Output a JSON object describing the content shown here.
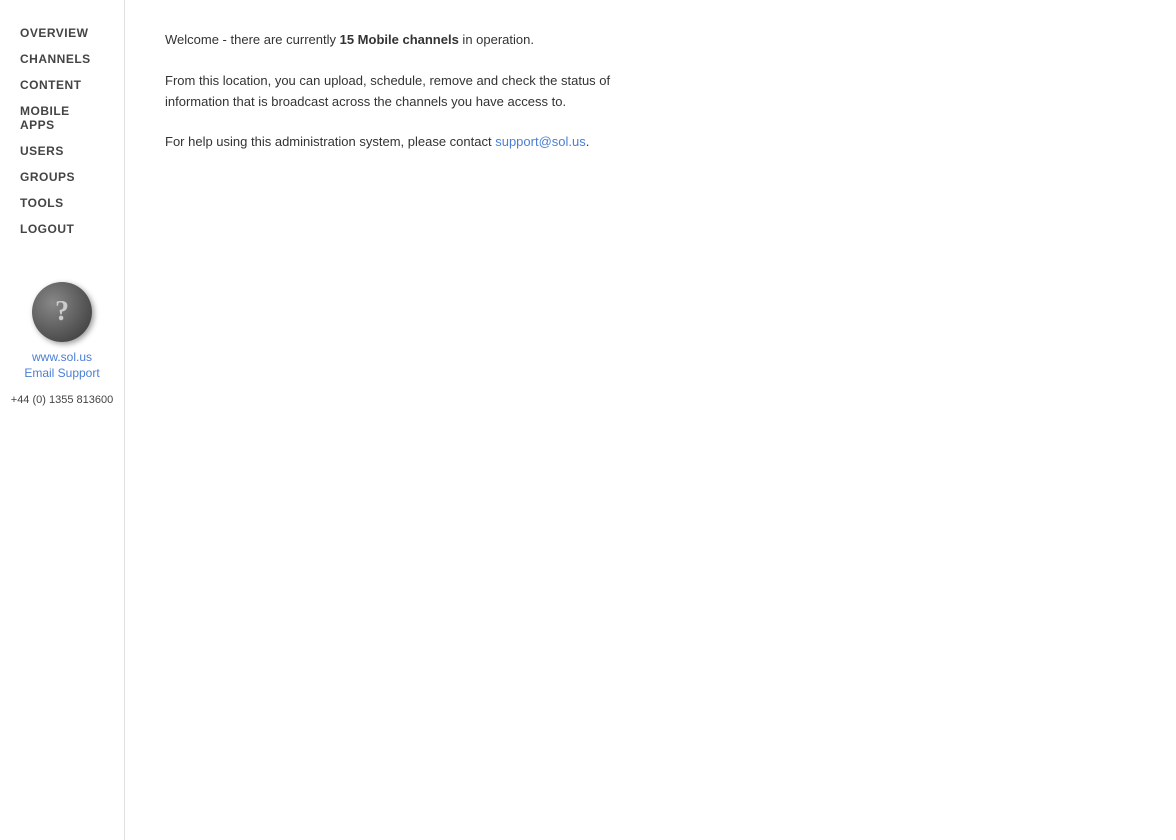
{
  "sidebar": {
    "nav_items": [
      {
        "label": "OVERVIEW",
        "id": "overview"
      },
      {
        "label": "CHANNELS",
        "id": "channels"
      },
      {
        "label": "CONTENT",
        "id": "content"
      },
      {
        "label": "MOBILE APPS",
        "id": "mobile-apps"
      },
      {
        "label": "USERS",
        "id": "users"
      },
      {
        "label": "GROUPS",
        "id": "groups"
      },
      {
        "label": "TOOLS",
        "id": "tools"
      },
      {
        "label": "LOGOUT",
        "id": "logout"
      }
    ],
    "website_url": "www.sol.us",
    "email_support_label": "Email Support",
    "phone": "+44 (0) 1355 813600"
  },
  "main": {
    "welcome_prefix": "Welcome - there are currently ",
    "channel_count": "15 Mobile channels",
    "welcome_suffix": " in operation.",
    "info_text": "From this location, you can upload, schedule, remove and check the status of information that is broadcast across the channels you have access to.",
    "help_prefix": "For help using this administration system, please contact ",
    "support_email": "support@sol.us",
    "help_suffix": "."
  }
}
